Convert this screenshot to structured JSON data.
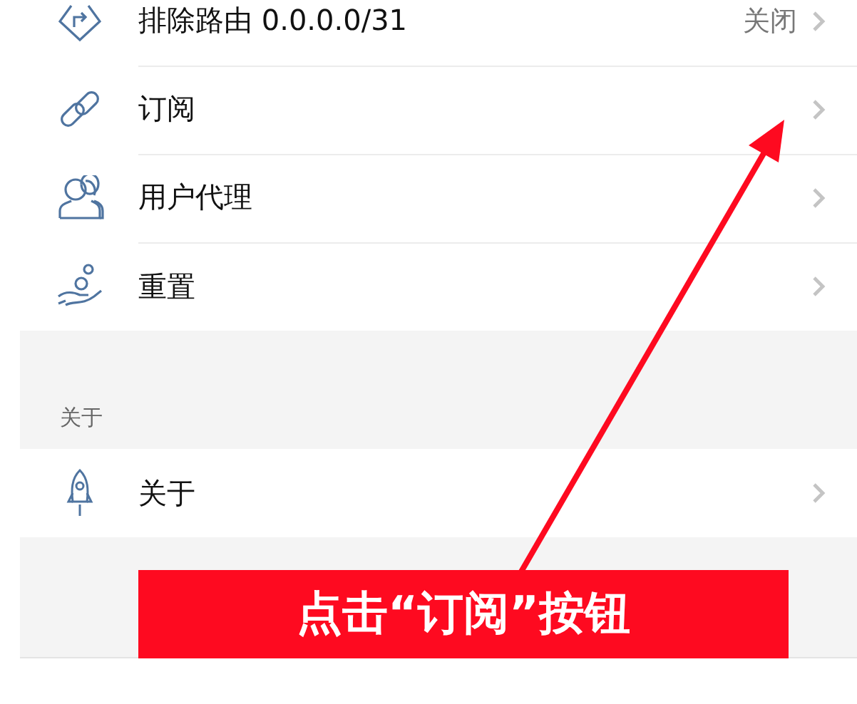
{
  "settings_rows": [
    {
      "label": "排除路由 0.0.0.0/31",
      "value": "关闭"
    },
    {
      "label": "订阅"
    },
    {
      "label": "用户代理"
    },
    {
      "label": "重置"
    }
  ],
  "about_section": {
    "header": "关于",
    "rows": [
      {
        "label": "关于"
      }
    ]
  },
  "annotation": {
    "text": "点击“订阅”按钮"
  }
}
